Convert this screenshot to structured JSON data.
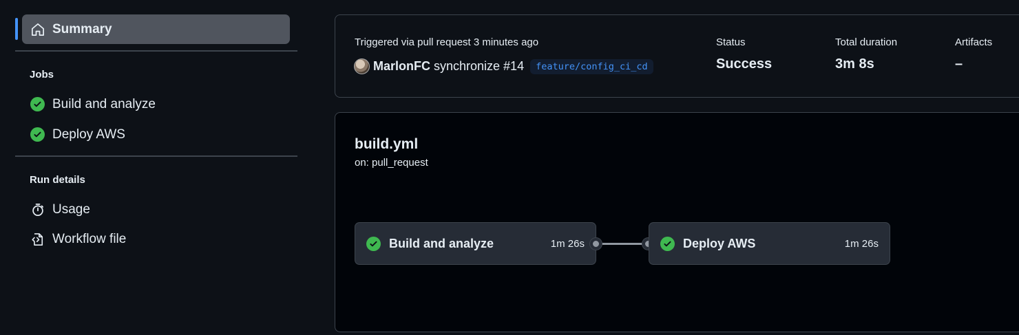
{
  "sidebar": {
    "summary_label": "Summary",
    "jobs_title": "Jobs",
    "jobs": [
      {
        "label": "Build and analyze",
        "status": "success"
      },
      {
        "label": "Deploy AWS",
        "status": "success"
      }
    ],
    "run_details_title": "Run details",
    "run_details": [
      {
        "label": "Usage",
        "icon": "stopwatch-icon"
      },
      {
        "label": "Workflow file",
        "icon": "file-code-icon"
      }
    ]
  },
  "summary": {
    "triggered": "Triggered via pull request 3 minutes ago",
    "actor": "MarlonFC",
    "action": "synchronize #14",
    "branch": "feature/config_ci_cd",
    "status_label": "Status",
    "status_value": "Success",
    "duration_label": "Total duration",
    "duration_value": "3m 8s",
    "artifacts_label": "Artifacts",
    "artifacts_value": "–"
  },
  "workflow": {
    "name": "build.yml",
    "trigger": "on: pull_request",
    "jobs": [
      {
        "name": "Build and analyze",
        "duration": "1m 26s"
      },
      {
        "name": "Deploy AWS",
        "duration": "1m 26s"
      }
    ]
  },
  "colors": {
    "success": "#3fb950",
    "accent": "#4493f8",
    "background": "#0d1117"
  }
}
